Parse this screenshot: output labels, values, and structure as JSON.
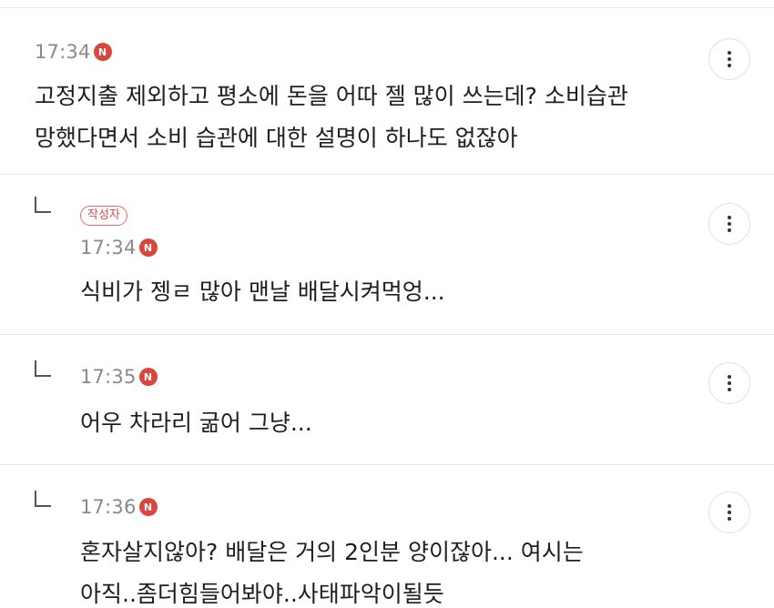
{
  "comments": [
    {
      "time": "17:34",
      "new_badge": "N",
      "lines": [
        "고정지출 제외하고 평소에 돈을 어따 젤 많이 쓰는데? 소비습관",
        "망했다면서 소비 습관에 대한 설명이 하나도 없잖아"
      ]
    },
    {
      "author_badge": "작성자",
      "time": "17:34",
      "new_badge": "N",
      "lines": [
        "식비가 젱ㄹ 많아 맨날 배달시켜먹엉..."
      ]
    },
    {
      "time": "17:35",
      "new_badge": "N",
      "lines": [
        "어우 차라리 굶어 그냥..."
      ]
    },
    {
      "time": "17:36",
      "new_badge": "N",
      "lines": [
        "혼자살지않아? 배달은 거의 2인분 양이잖아... 여시는",
        "아직..좀더힘들어봐야..사태파악이될듯"
      ]
    }
  ],
  "icons": {
    "more": "more-vertical-icon",
    "reply": "reply-arrow-icon"
  },
  "colors": {
    "badge_red": "#d9463d",
    "author_badge": "#d84b4b",
    "time_gray": "#8a8a8a",
    "divider": "#e6e6e6"
  }
}
